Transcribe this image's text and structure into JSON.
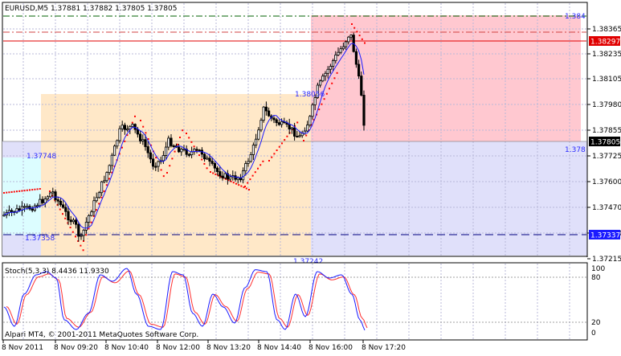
{
  "window": {
    "symbol_header": "EURUSD,M5  1.37881 1.37882 1.37805 1.37805"
  },
  "main_chart": {
    "price_ticks": [
      "1.38365",
      "1.38235",
      "1.38105",
      "1.37980",
      "1.37855",
      "1.37725",
      "1.37600",
      "1.37470",
      "1.37340",
      "1.37215"
    ],
    "price_boxes": [
      {
        "label": "1.38297",
        "color": "#e00000",
        "text_color": "#ffffff",
        "kind": "resistance"
      },
      {
        "label": "1.37805",
        "color": "#000000",
        "text_color": "#ffffff",
        "kind": "current"
      },
      {
        "label": "1.37337",
        "color": "#1a1aff",
        "text_color": "#ffffff",
        "kind": "support"
      }
    ],
    "level_labels": [
      {
        "text": "1.384",
        "color": "#2a2aff",
        "kind": "top"
      },
      {
        "text": "1.37748",
        "color": "#2a2aff",
        "kind": "range-top"
      },
      {
        "text": "1.37358",
        "color": "#2a2aff",
        "kind": "range-bottom"
      },
      {
        "text": "1.38056",
        "color": "#2a2aff",
        "kind": "box-mid"
      },
      {
        "text": "1.378",
        "color": "#2a2aff",
        "kind": "right-cut"
      },
      {
        "text": "1.37242",
        "color": "#2a2aff",
        "kind": "bottom-cut"
      }
    ],
    "colors": {
      "grid": "#b9b9d9",
      "orange_zone": "#ffe8c8",
      "pink_zone": "#ffc8d0",
      "cyan_zone": "#dcfdff",
      "lavender_zone": "#e0e0fa",
      "candle_bull": "#000000",
      "candle_bear": "#000000",
      "moving_average": "#1a1aff",
      "sar": "#ff0000",
      "resistance_line": "#e00000",
      "support_line": "#000080",
      "top_line": "#006000"
    }
  },
  "stochastic": {
    "label": "Stoch(5,3,3) 8.4436 11.9330",
    "levels": [
      "100",
      "80",
      "20",
      "0"
    ],
    "main_color": "#1a1aff",
    "signal_color": "#ff3030"
  },
  "footer": {
    "copyright": "Alpari MT4, © 2001-2011 MetaQuotes Software Corp."
  },
  "time_axis": [
    "8 Nov 2011",
    "8 Nov 09:20",
    "8 Nov 10:40",
    "8 Nov 12:00",
    "8 Nov 13:20",
    "8 Nov 14:40",
    "8 Nov 16:00",
    "8 Nov 17:20"
  ]
}
